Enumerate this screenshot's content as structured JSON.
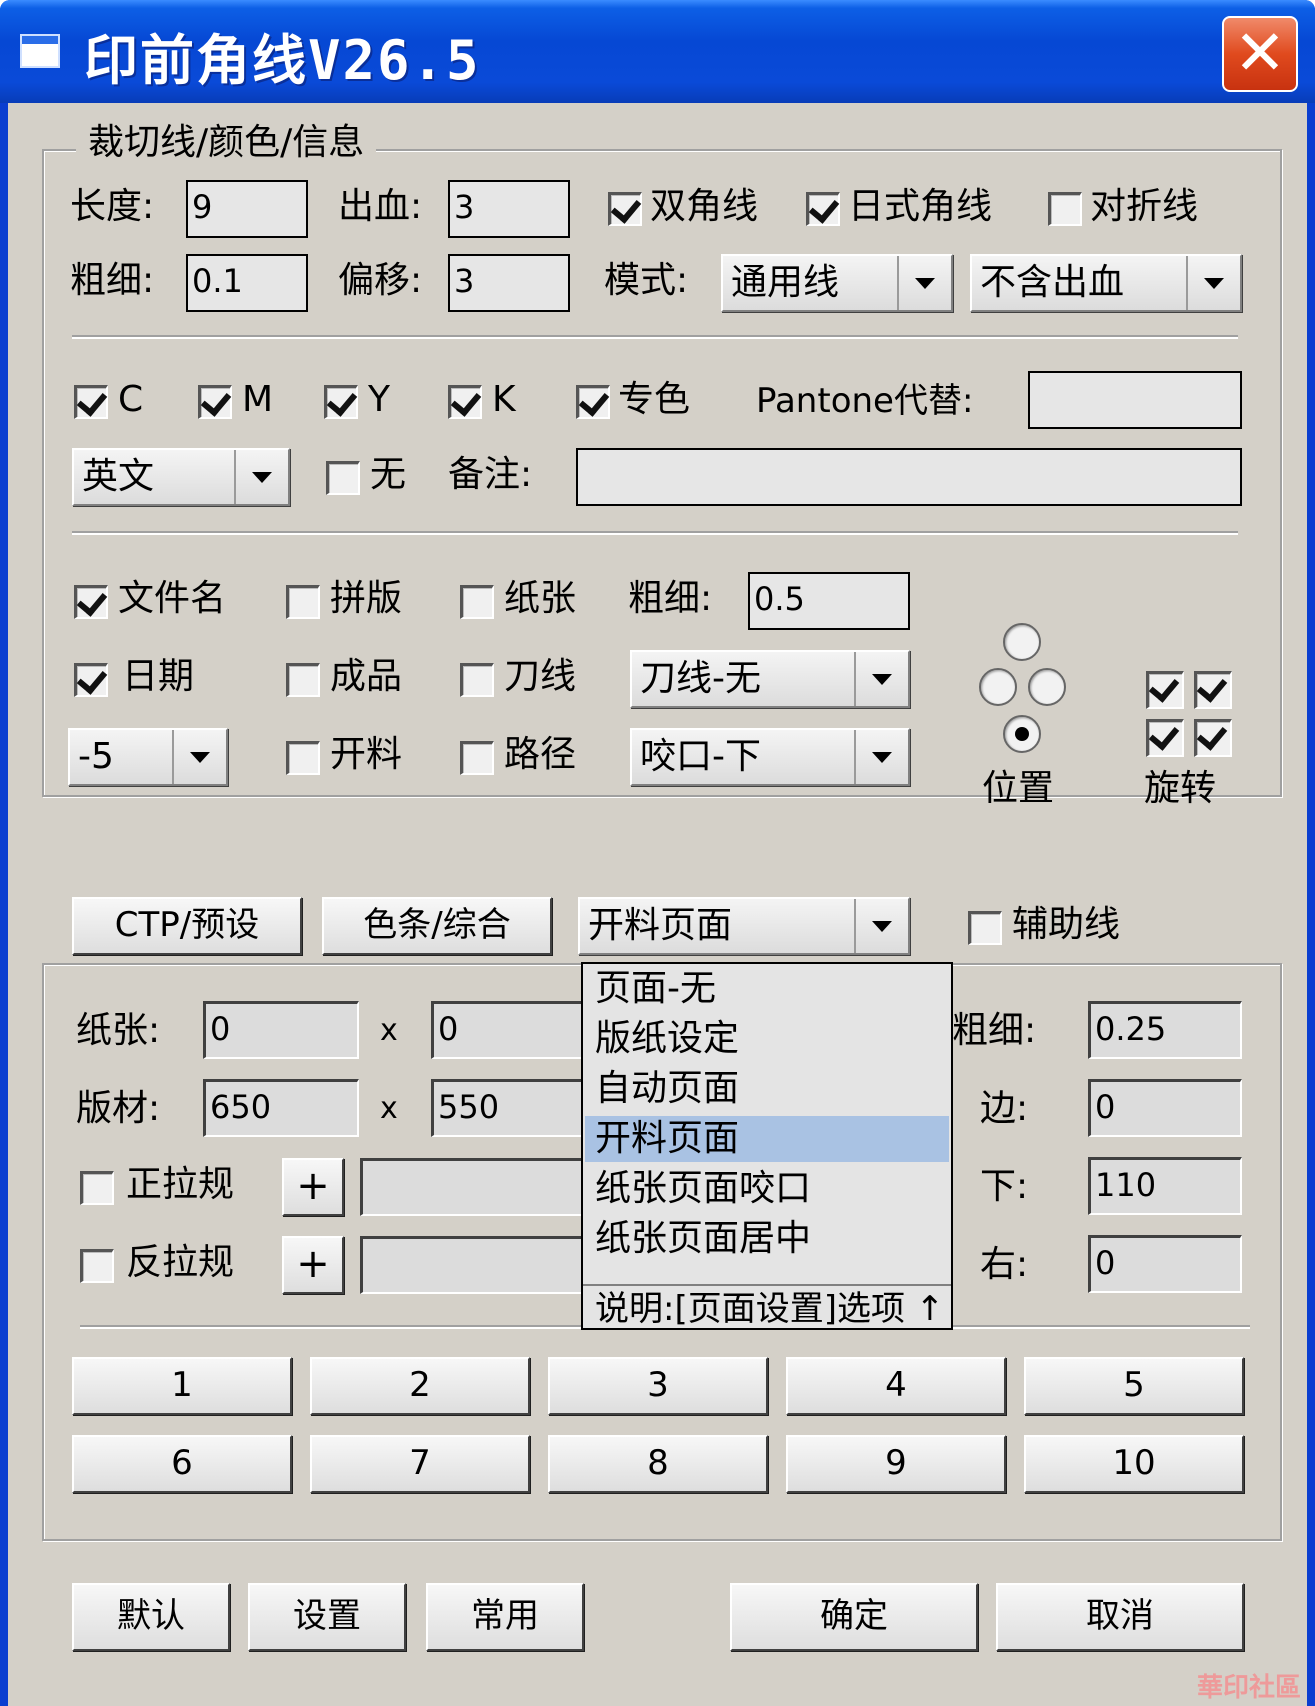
{
  "window": {
    "title": "印前角线V26.5",
    "close_label": "✕"
  },
  "group_crop": {
    "legend": "裁切线/颜色/信息",
    "length_label": "长度:",
    "length_value": "9",
    "bleed_label": "出血:",
    "bleed_value": "3",
    "double_corner_label": "双角线",
    "japanese_corner_label": "日式角线",
    "fold_line_label": "对折线",
    "thickness_label": "粗细:",
    "thickness_value": "0.1",
    "offset_label": "偏移:",
    "offset_value": "3",
    "mode_label": "模式:",
    "mode_value": "通用线",
    "bleed_mode_value": "不含出血"
  },
  "colors": {
    "c_label": "C",
    "m_label": "M",
    "y_label": "Y",
    "k_label": "K",
    "spot_label": "专色",
    "pantone_label": "Pantone代替:",
    "pantone_value": "",
    "language_value": "英文",
    "none_label": "无",
    "note_label": "备注:",
    "note_value": ""
  },
  "info": {
    "filename_label": "文件名",
    "imposition_label": "拼版",
    "paper_label": "纸张",
    "thickness_label": "粗细:",
    "thickness_value": "0.5",
    "date_label": "日期",
    "finished_label": "成品",
    "knife_label": "刀线",
    "knife_value": "刀线-无",
    "offset_value": "-5",
    "cut_label": "开料",
    "path_label": "路径",
    "grip_value": "咬口-下",
    "position_label": "位置",
    "rotate_label": "旋转"
  },
  "tabs": {
    "ctp_label": "CTP/预设",
    "colorbar_label": "色条/综合",
    "page_value": "开料页面",
    "guide_label": "辅助线"
  },
  "lower": {
    "paper_label": "纸张:",
    "paper_w": "0",
    "paper_h": "0",
    "x_label": "x",
    "plate_label": "版材:",
    "plate_w": "650",
    "plate_h": "550",
    "front_pull_label": "正拉规",
    "back_pull_label": "反拉规",
    "plus_label": "+",
    "thick_label": "粗细:",
    "thick_value": "0.25",
    "edge_label": "边:",
    "edge_value": "0",
    "ud_label": "下:",
    "ud_value": "110",
    "lr_label": "右:",
    "lr_value": "0"
  },
  "preset_buttons": [
    "1",
    "2",
    "3",
    "4",
    "5",
    "6",
    "7",
    "8",
    "9",
    "10"
  ],
  "dropdown": {
    "items": [
      "页面-无",
      "版纸设定",
      "自动页面",
      "开料页面",
      "纸张页面咬口",
      "纸张页面居中"
    ],
    "selected_index": 3,
    "note": "说明:[页面设置]选项 ↑"
  },
  "footer": {
    "default_label": "默认",
    "settings_label": "设置",
    "common_label": "常用",
    "ok_label": "确定",
    "cancel_label": "取消"
  },
  "watermark": "華印社區"
}
